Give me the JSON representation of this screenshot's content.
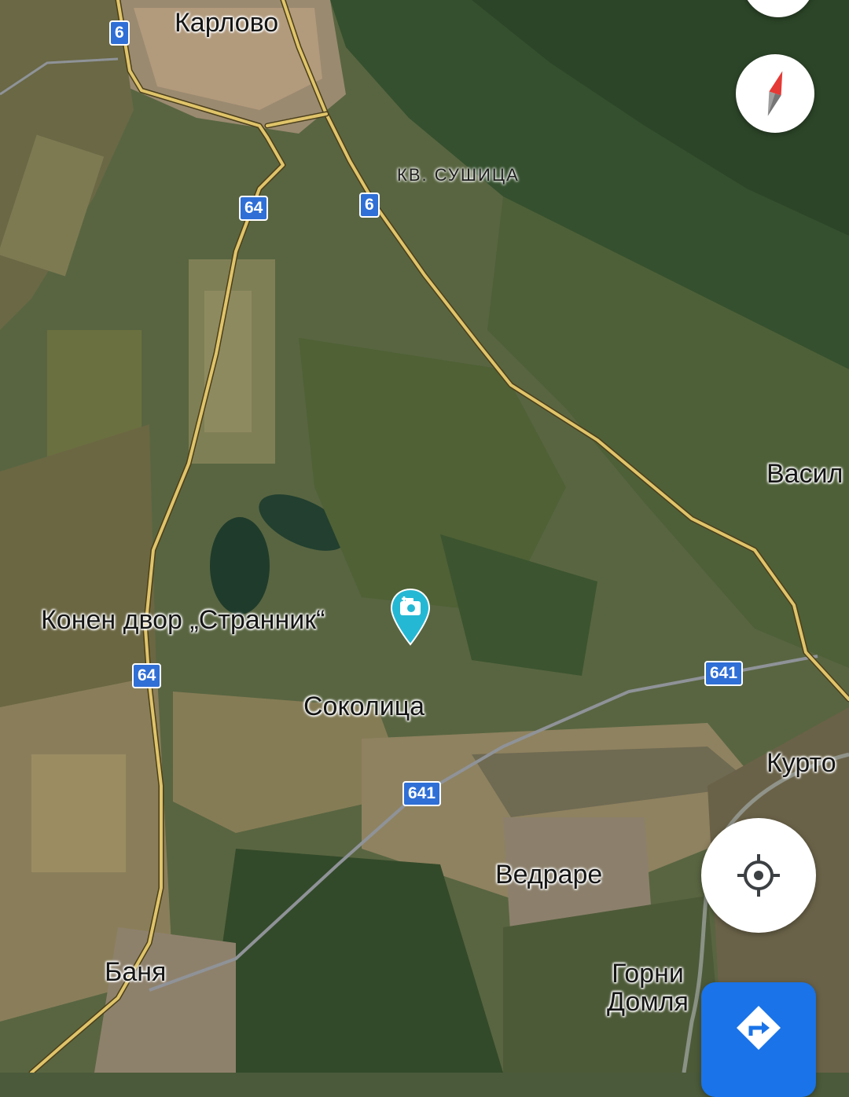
{
  "places": {
    "karlovo": "Карлово",
    "sushitsa": "КВ. СУШИЦА",
    "vasil": "Васил",
    "sokolitsa": "Соколица",
    "kurto": "Курто",
    "vedrare": "Ведраре",
    "gorni_line1": "Горни",
    "gorni_line2": "Домля",
    "banya": "Баня"
  },
  "poi": {
    "label": "Конен двор „Странник“",
    "icon": "camera-icon"
  },
  "roads": {
    "r6_a": "6",
    "r6_b": "6",
    "r64_a": "64",
    "r64_b": "64",
    "r641_a": "641",
    "r641_b": "641"
  },
  "controls": {
    "compass": "compass-icon",
    "my_location": "my-location-icon",
    "directions": "directions-icon"
  },
  "colors": {
    "road_major": "#e0c46a",
    "shield": "#2f6fd6",
    "poi": "#25b8d4",
    "directions_button": "#1a73e8"
  }
}
